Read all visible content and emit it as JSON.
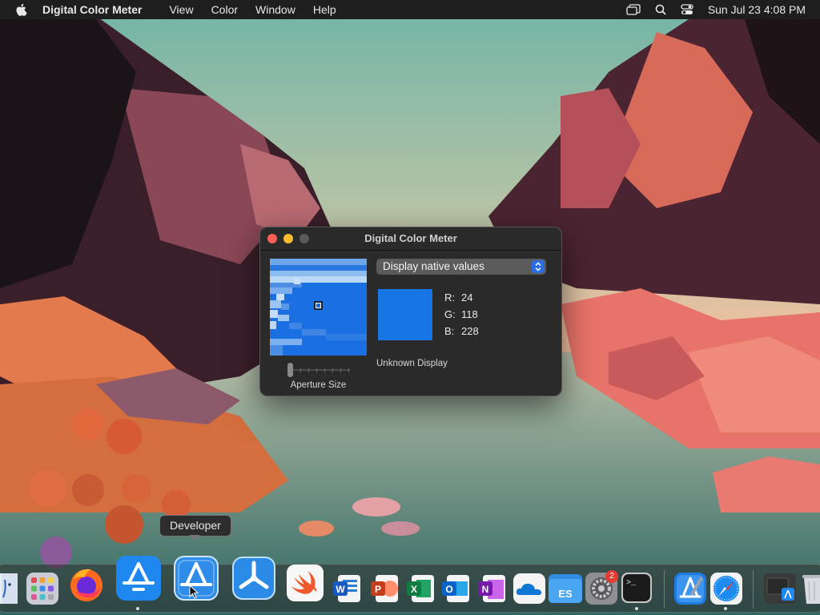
{
  "menubar": {
    "app_name": "Digital Color Meter",
    "items": [
      "View",
      "Color",
      "Window",
      "Help"
    ],
    "clock": "Sun Jul 23  4:08 PM"
  },
  "window": {
    "title": "Digital Color Meter",
    "mode_select": "Display native values",
    "rgb": {
      "r_label": "R:",
      "r": "24",
      "g_label": "G:",
      "g": "118",
      "b_label": "B:",
      "b": "228"
    },
    "sample_color": "#1876e4",
    "aperture_label": "Aperture Size",
    "display_label": "Unknown Display"
  },
  "tooltip": "Developer",
  "dock": {
    "items": [
      "finder-icon",
      "launchpad-icon",
      "firefox-icon",
      "app-store-icon",
      "developer-icon",
      "testflight-icon",
      "swift-playgrounds-icon",
      "word-icon",
      "powerpoint-icon",
      "excel-icon",
      "outlook-icon",
      "onenote-icon",
      "onedrive-icon",
      "files-icon",
      "system-settings-icon",
      "terminal-icon",
      "xcode-icon",
      "safari-icon",
      "downloads-icon",
      "trash-icon"
    ],
    "settings_badge": "2"
  }
}
